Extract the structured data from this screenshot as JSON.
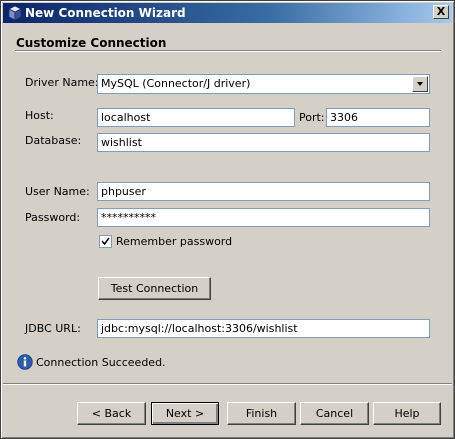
{
  "window": {
    "title": "New Connection Wizard",
    "close_symbol": "X"
  },
  "section": {
    "title": "Customize Connection"
  },
  "form": {
    "driver_label": "Driver Name:",
    "driver_value": "MySQL (Connector/J driver)",
    "host_label": "Host:",
    "host_value": "localhost",
    "port_label": "Port:",
    "port_value": "3306",
    "database_label": "Database:",
    "database_value": "wishlist",
    "username_label": "User Name:",
    "username_value": "phpuser",
    "password_label": "Password:",
    "password_value": "**********",
    "remember_label": "Remember password",
    "remember_checked": true,
    "test_button": "Test Connection",
    "jdbc_label": "JDBC URL:",
    "jdbc_value": "jdbc:mysql://localhost:3306/wishlist"
  },
  "status": {
    "message": "Connection Succeeded.",
    "icon": "info-icon"
  },
  "footer": {
    "back": "< Back",
    "next": "Next >",
    "finish": "Finish",
    "cancel": "Cancel",
    "help": "Help"
  },
  "colors": {
    "titlebar_start": "#0a246a",
    "titlebar_end": "#a6caf0",
    "face": "#d4d0c8",
    "field_border": "#7f9db9",
    "info_blue": "#2a5db0"
  }
}
